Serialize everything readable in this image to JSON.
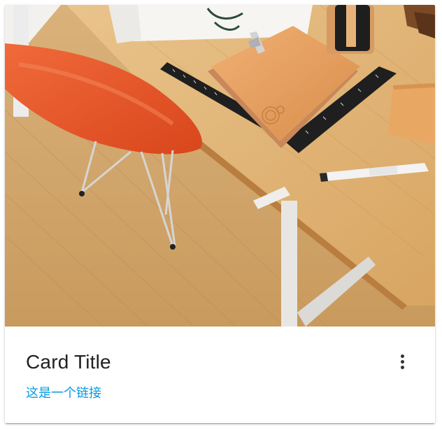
{
  "card": {
    "title": "Card Title",
    "link_text": "这是一个链接",
    "more_icon": "more-vert-icon",
    "image_description_icon": "photo",
    "colors": {
      "link": "#039be5",
      "title": "#212121",
      "icon": "#333333"
    }
  }
}
